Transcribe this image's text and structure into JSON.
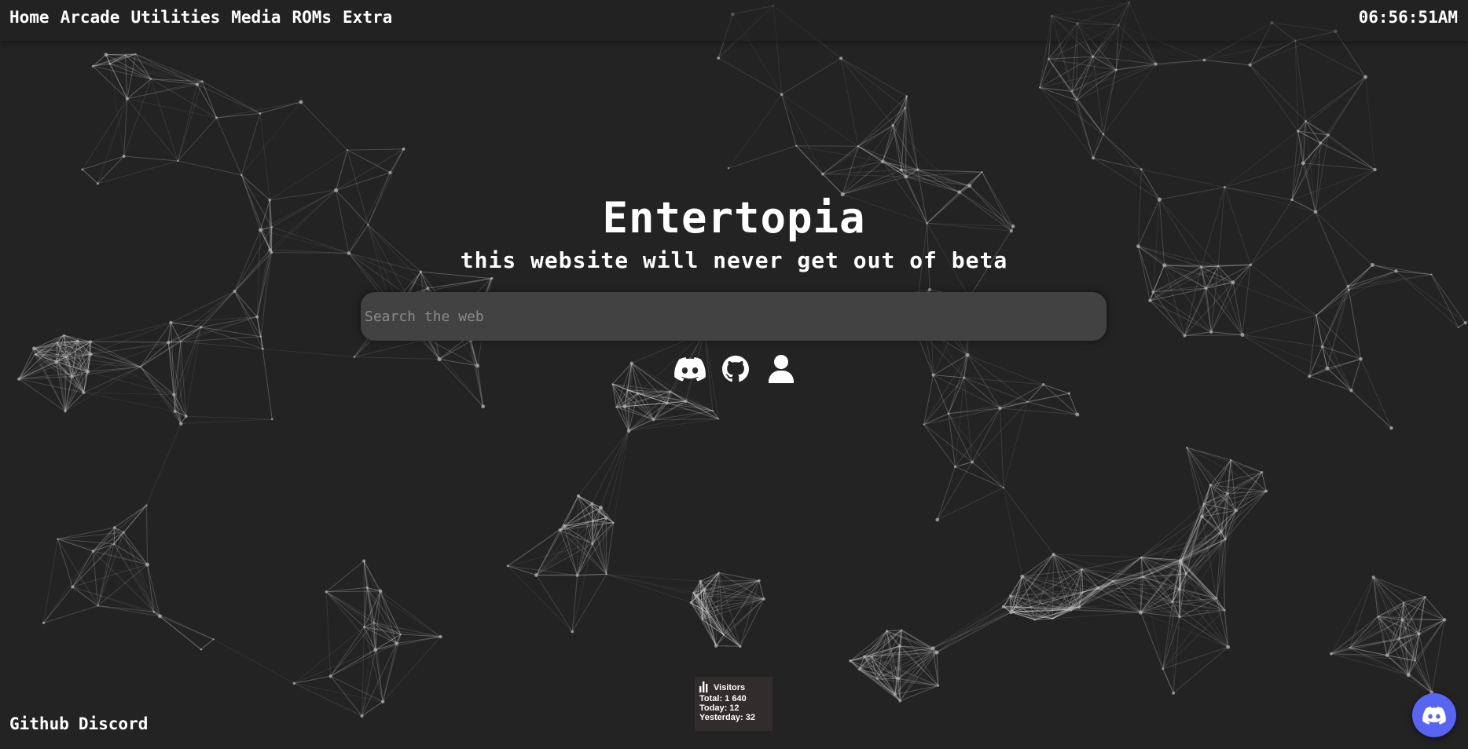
{
  "nav": {
    "items": [
      {
        "label": "Home"
      },
      {
        "label": "Arcade"
      },
      {
        "label": "Utilities"
      },
      {
        "label": "Media"
      },
      {
        "label": "ROMs"
      },
      {
        "label": "Extra"
      }
    ]
  },
  "clock": {
    "time": "06:56:51AM"
  },
  "hero": {
    "title": "Entertopia",
    "subtitle": "this website will never get out of beta"
  },
  "search": {
    "placeholder": "Search the web",
    "value": ""
  },
  "socials": [
    {
      "icon": "discord-icon"
    },
    {
      "icon": "github-icon"
    },
    {
      "icon": "user-icon"
    }
  ],
  "footer": {
    "links": [
      {
        "label": "Github"
      },
      {
        "label": "Discord"
      }
    ]
  },
  "visitors": {
    "icon": "bar-chart-icon",
    "title": "Visitors",
    "total": "Total: 1 640",
    "today": "Today: 12",
    "yesterday": "Yesterday: 32"
  },
  "discord_widget": {
    "icon": "discord-icon",
    "color": "#5865f2"
  },
  "colors": {
    "background": "#232323",
    "search_bg": "#424242",
    "text": "#ffffff",
    "discord_brand": "#5865f2"
  }
}
